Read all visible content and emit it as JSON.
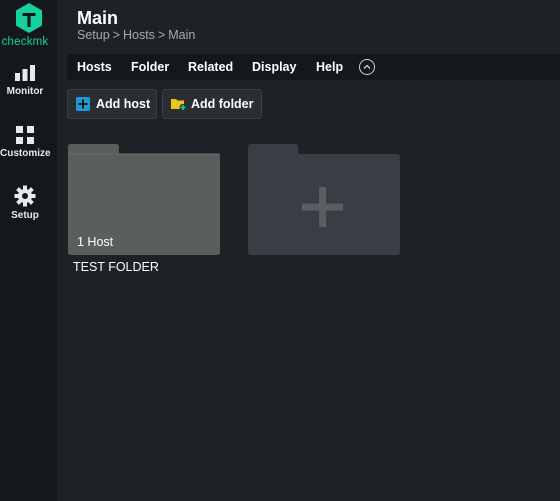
{
  "sidebar": {
    "logo_text": "checkmk",
    "items": [
      {
        "label": "Monitor",
        "icon": "monitor-icon"
      },
      {
        "label": "Customize",
        "icon": "customize-icon"
      },
      {
        "label": "Setup",
        "icon": "setup-icon"
      }
    ]
  },
  "header": {
    "title": "Main",
    "breadcrumb": [
      "Setup",
      "Hosts",
      "Main"
    ],
    "breadcrumb_separator": ">"
  },
  "menu": {
    "items": [
      "Hosts",
      "Folder",
      "Related",
      "Display",
      "Help"
    ]
  },
  "actions": {
    "add_host": "Add host",
    "add_folder": "Add folder"
  },
  "folders": [
    {
      "name": "TEST FOLDER",
      "count_label": "1 Host"
    }
  ],
  "colors": {
    "accent": "#15d1a0",
    "background": "#1e2125",
    "sidebar": "#15181b",
    "folder": "#5a5e5c",
    "add_host_icon": "#1e9bd7",
    "add_folder_icon": "#f0c419"
  }
}
